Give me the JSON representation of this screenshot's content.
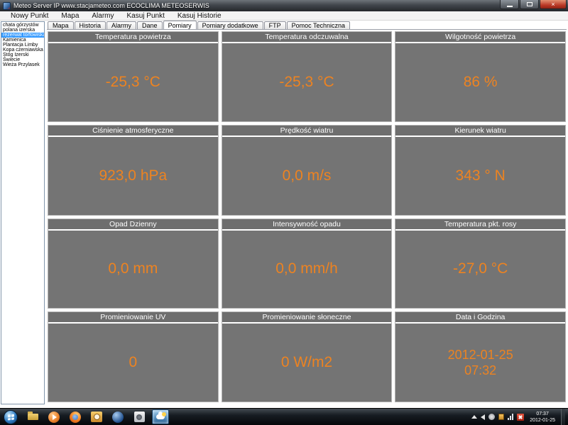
{
  "window": {
    "title": "Meteo Server IP www.stacjameteo.com ECOCLIMA METEOSERWIS",
    "controls": {
      "close_glyph": "×"
    }
  },
  "menu": {
    "items": [
      {
        "label": "Nowy Punkt"
      },
      {
        "label": "Mapa"
      },
      {
        "label": "Alarmy"
      },
      {
        "label": "Kasuj Punkt"
      },
      {
        "label": "Kasuj Historie"
      }
    ]
  },
  "sidebar": {
    "items": [
      {
        "label": "chata górzystów"
      },
      {
        "label": "polana izerska"
      },
      {
        "label": "rezerwat torfowiska",
        "selected": true
      },
      {
        "label": "Kamienica"
      },
      {
        "label": "Plantacja Limby"
      },
      {
        "label": "Kopa czerniawska"
      },
      {
        "label": "Stóg Izerski"
      },
      {
        "label": "Świecie"
      },
      {
        "label": "Wieża Przylasek"
      }
    ]
  },
  "tabs": {
    "items": [
      {
        "label": "Mapa"
      },
      {
        "label": "Historia"
      },
      {
        "label": "Alarmy"
      },
      {
        "label": "Dane"
      },
      {
        "label": "Pomiary",
        "active": true
      },
      {
        "label": "Pomiary dodatkowe"
      },
      {
        "label": "FTP"
      },
      {
        "label": "Pomoc Techniczna"
      }
    ]
  },
  "panels": [
    {
      "title": "Temperatura powietrza",
      "value": "-25,3 °C"
    },
    {
      "title": "Temperatura odczuwalna",
      "value": "-25,3 °C"
    },
    {
      "title": "Wilgotność powietrza",
      "value": "86 %"
    },
    {
      "title": "Ciśnienie atmosferyczne",
      "value": "923,0 hPa"
    },
    {
      "title": "Prędkość wiatru",
      "value": "0,0 m/s"
    },
    {
      "title": "Kierunek wiatru",
      "value": "343 ° N"
    },
    {
      "title": "Opad Dzienny",
      "value": "0,0 mm"
    },
    {
      "title": "Intensywność opadu",
      "value": "0,0 mm/h"
    },
    {
      "title": "Temperatura pkt. rosy",
      "value": "-27,0 °C"
    },
    {
      "title": "Promieniowanie UV",
      "value": "0"
    },
    {
      "title": "Promieniowanie słoneczne",
      "value": "0 W/m2"
    },
    {
      "title": "Data i Godzina",
      "value": "2012-01-25",
      "value2": "07:32"
    }
  ],
  "taskbar": {
    "apps": [
      {
        "name": "windows-explorer",
        "active": false
      },
      {
        "name": "windows-media-player",
        "active": false
      },
      {
        "name": "firefox",
        "active": false
      },
      {
        "name": "mail-clock-app",
        "active": false
      },
      {
        "name": "blue-round-app",
        "active": false
      },
      {
        "name": "audio-app",
        "active": false
      },
      {
        "name": "meteo-weather-app",
        "active": true
      }
    ],
    "tray_icons": [
      "expand-arrow",
      "volume",
      "status-circle",
      "lock",
      "network-bars",
      "action-center-flag"
    ],
    "clock": {
      "time": "07:37",
      "date": "2012-01-25"
    }
  },
  "colors": {
    "accent_orange": "#ED8321",
    "panel_gray": "#747474",
    "panel_header_gray": "#6E6E6E",
    "selection_blue": "#3399FF",
    "header_text": "#FFFFFF"
  }
}
